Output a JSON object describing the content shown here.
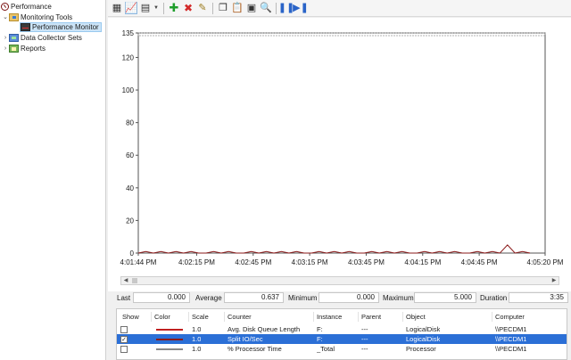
{
  "tree": {
    "root": "Performance",
    "monitoring_tools": "Monitoring Tools",
    "performance_monitor": "Performance Monitor",
    "data_collector_sets": "Data Collector Sets",
    "reports": "Reports"
  },
  "toolbar": {
    "icons": [
      "view-current-activity-icon",
      "change-graph-type-icon",
      "add-counter-icon",
      "delete-counter-icon",
      "highlight-icon",
      "copy-properties-icon",
      "paste-counter-list-icon",
      "properties-icon",
      "zoom-icon",
      "freeze-display-icon",
      "update-data-icon"
    ],
    "colors": {
      "add": "#1f9e2c",
      "delete": "#d32a2a",
      "highlight": "#9a7a1a",
      "pause": "#2a64c8"
    }
  },
  "chart_data": {
    "type": "line",
    "ylim": [
      0,
      135
    ],
    "y_ticks": [
      "135",
      "120",
      "100",
      "80",
      "60",
      "40",
      "20",
      "0"
    ],
    "y_tick_values": [
      135,
      120,
      100,
      80,
      60,
      40,
      20,
      0
    ],
    "x_tick_labels": [
      "4:01:44 PM",
      "4:02:15 PM",
      "4:02:45 PM",
      "4:03:15 PM",
      "4:03:45 PM",
      "4:04:15 PM",
      "4:04:45 PM",
      "4:05:20 PM"
    ],
    "x_tick_seconds": [
      0,
      31,
      61,
      91,
      121,
      151,
      181,
      216
    ],
    "series": [
      {
        "color": "#8b1a1a",
        "x_seconds": [
          0,
          4,
          8,
          12,
          16,
          20,
          24,
          28,
          32,
          36,
          40,
          44,
          48,
          52,
          56,
          60,
          64,
          68,
          72,
          76,
          80,
          84,
          88,
          92,
          96,
          100,
          104,
          108,
          112,
          116,
          120,
          124,
          128,
          132,
          136,
          140,
          144,
          148,
          152,
          156,
          160,
          164,
          168,
          172,
          176,
          180,
          184,
          188,
          192,
          196,
          200,
          204,
          208
        ],
        "values": [
          0,
          1,
          0,
          1,
          0,
          1,
          0,
          1,
          0,
          0,
          1,
          0,
          1,
          0,
          0,
          1,
          0,
          1,
          0,
          1,
          0,
          1,
          0,
          0,
          1,
          0,
          1,
          0,
          1,
          0,
          0,
          1,
          0,
          1,
          0,
          1,
          0,
          0,
          1,
          0,
          1,
          0,
          1,
          0,
          0,
          1,
          0,
          1,
          0,
          5,
          0,
          1,
          0
        ]
      }
    ]
  },
  "stats": {
    "last_label": "Last",
    "last_value": "0.000",
    "average_label": "Average",
    "average_value": "0.637",
    "minimum_label": "Minimum",
    "minimum_value": "0.000",
    "maximum_label": "Maximum",
    "maximum_value": "5.000",
    "duration_label": "Duration",
    "duration_value": "3:35"
  },
  "legend": {
    "headers": [
      "Show",
      "Color",
      "Scale",
      "Counter",
      "Instance",
      "Parent",
      "Object",
      "Computer"
    ],
    "rows": [
      {
        "show": false,
        "color": "#c02020",
        "scale": "1.0",
        "counter": "Avg. Disk Queue Length",
        "instance": "F:",
        "parent": "---",
        "object": "LogicalDisk",
        "computer": "\\\\PECDM1",
        "selected": false
      },
      {
        "show": true,
        "color": "#8b1a1a",
        "scale": "1.0",
        "counter": "Split IO/Sec",
        "instance": "F:",
        "parent": "---",
        "object": "LogicalDisk",
        "computer": "\\\\PECDM1",
        "selected": true
      },
      {
        "show": false,
        "color": "#8a8a8a",
        "scale": "1.0",
        "counter": "% Processor Time",
        "instance": "_Total",
        "parent": "---",
        "object": "Processor",
        "computer": "\\\\PECDM1",
        "selected": false
      }
    ]
  }
}
